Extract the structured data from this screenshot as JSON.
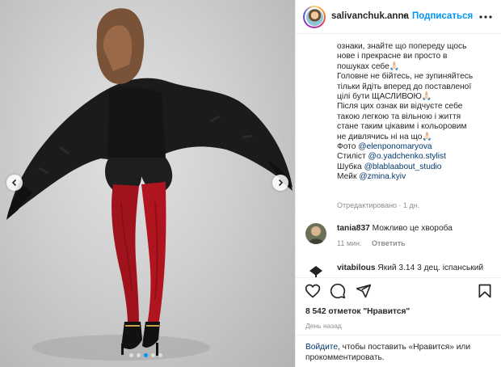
{
  "post": {
    "username": "salivanchuk.anna",
    "separator": "•",
    "follow_label": "Подписаться",
    "image_alt": "photo",
    "slide_count": 5,
    "active_slide": 3
  },
  "caption": {
    "cut_line": "ознаки, знайте що попереду щось",
    "lines": [
      "ознаки, знайте що попереду щось",
      "нове і прекрасне ви просто в",
      "пошуках себе🙏🏻",
      "Головне не бійтесь, не зупиняйтесь",
      "тільки йдіть вперед до поставленої",
      "цілі бути ЩАСЛИВОЮ🙏🏻",
      "Після цих ознак ви відчуєте себе",
      "такою легкою та вільною і життя",
      "стане таким цікавим і кольоровим",
      "не дивлячись ні на що🙏🏻"
    ],
    "credits": [
      {
        "label": "Фото",
        "tag": "@elenponomaryova"
      },
      {
        "label": "Стиліст",
        "tag": "@o.yadchenko.stylist"
      },
      {
        "label": "Шубка",
        "tag": "@blablaabout_studio"
      },
      {
        "label": "Мейк",
        "tag": "@zmina.kyiv"
      }
    ],
    "edited": "Отредактировано · 1 дн."
  },
  "comments": [
    {
      "user": "tania837",
      "text": "Можливо це хвороба",
      "time": "11 мин.",
      "reply": "Ответить"
    },
    {
      "user": "vitabilous",
      "text": "Який 3.14 3 дец. іспанський",
      "time": "",
      "reply": ""
    }
  ],
  "likes": "8 542 отметок \"Нравится\"",
  "date": "День назад",
  "footer": {
    "login_link": "Войдите",
    "text": ", чтобы поставить «Нравится» или прокомментировать."
  },
  "colors": {
    "accent": "#0095f6",
    "link": "#00376b",
    "muted": "#8e8e8e",
    "text": "#262626"
  },
  "icons": {
    "more": "more-horizontal-icon",
    "like": "heart-icon",
    "comment": "comment-bubble-icon",
    "share": "paper-plane-icon",
    "save": "bookmark-icon",
    "prev": "chevron-left-icon",
    "next": "chevron-right-icon"
  }
}
